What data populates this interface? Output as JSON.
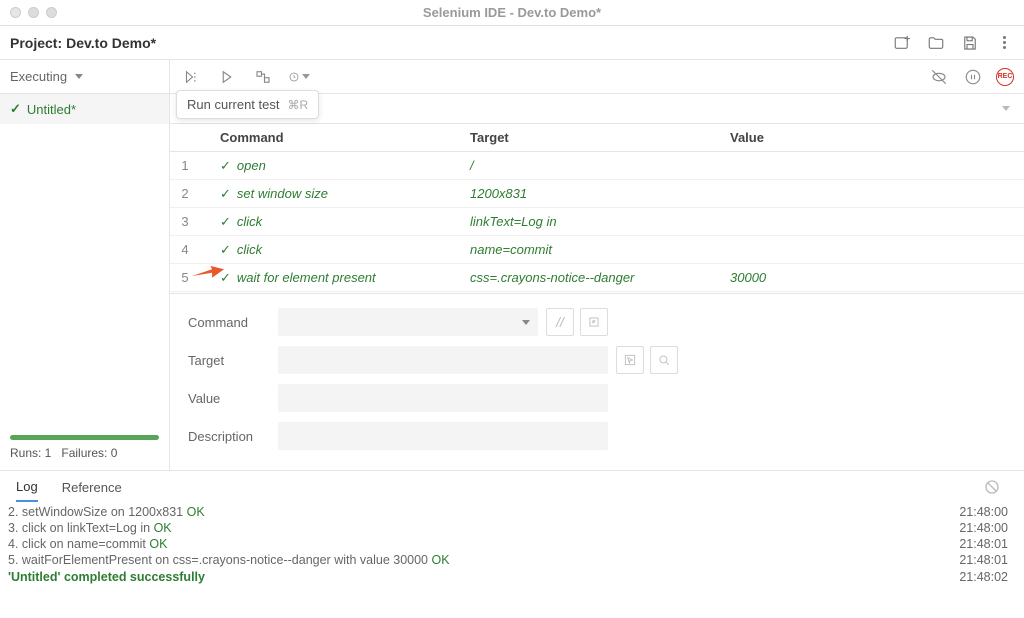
{
  "window": {
    "title": "Selenium IDE - Dev.to Demo*"
  },
  "project": {
    "label": "Project:",
    "name": "Dev.to Demo*"
  },
  "sidebar": {
    "exec_label": "Executing",
    "test_name": "Untitled*",
    "runs_label": "Runs: 1",
    "failures_label": "Failures: 0"
  },
  "toolbar": {
    "tooltip_text": "Run current test",
    "tooltip_shortcut": "⌘R"
  },
  "table": {
    "headers": {
      "command": "Command",
      "target": "Target",
      "value": "Value"
    },
    "rows": [
      {
        "idx": "1",
        "cmd": "open",
        "target": "/",
        "value": ""
      },
      {
        "idx": "2",
        "cmd": "set window size",
        "target": "1200x831",
        "value": ""
      },
      {
        "idx": "3",
        "cmd": "click",
        "target": "linkText=Log in",
        "value": ""
      },
      {
        "idx": "4",
        "cmd": "click",
        "target": "name=commit",
        "value": ""
      },
      {
        "idx": "5",
        "cmd": "wait for element present",
        "target": "css=.crayons-notice--danger",
        "value": "30000"
      }
    ]
  },
  "editor": {
    "command_label": "Command",
    "target_label": "Target",
    "value_label": "Value",
    "desc_label": "Description"
  },
  "tabs": {
    "log": "Log",
    "reference": "Reference"
  },
  "log": {
    "lines": [
      {
        "text_pre": "2.  setWindowSize on 1200x831 ",
        "ok": "OK",
        "time": "21:48:00"
      },
      {
        "text_pre": "3.  click on linkText=Log in ",
        "ok": "OK",
        "time": "21:48:00"
      },
      {
        "text_pre": "4.  click on name=commit ",
        "ok": "OK",
        "time": "21:48:01"
      },
      {
        "text_pre": "5.  waitForElementPresent on css=.crayons-notice--danger with value 30000 ",
        "ok": "OK",
        "time": "21:48:01"
      }
    ],
    "success_text": "'Untitled' completed successfully",
    "success_time": "21:48:02"
  }
}
